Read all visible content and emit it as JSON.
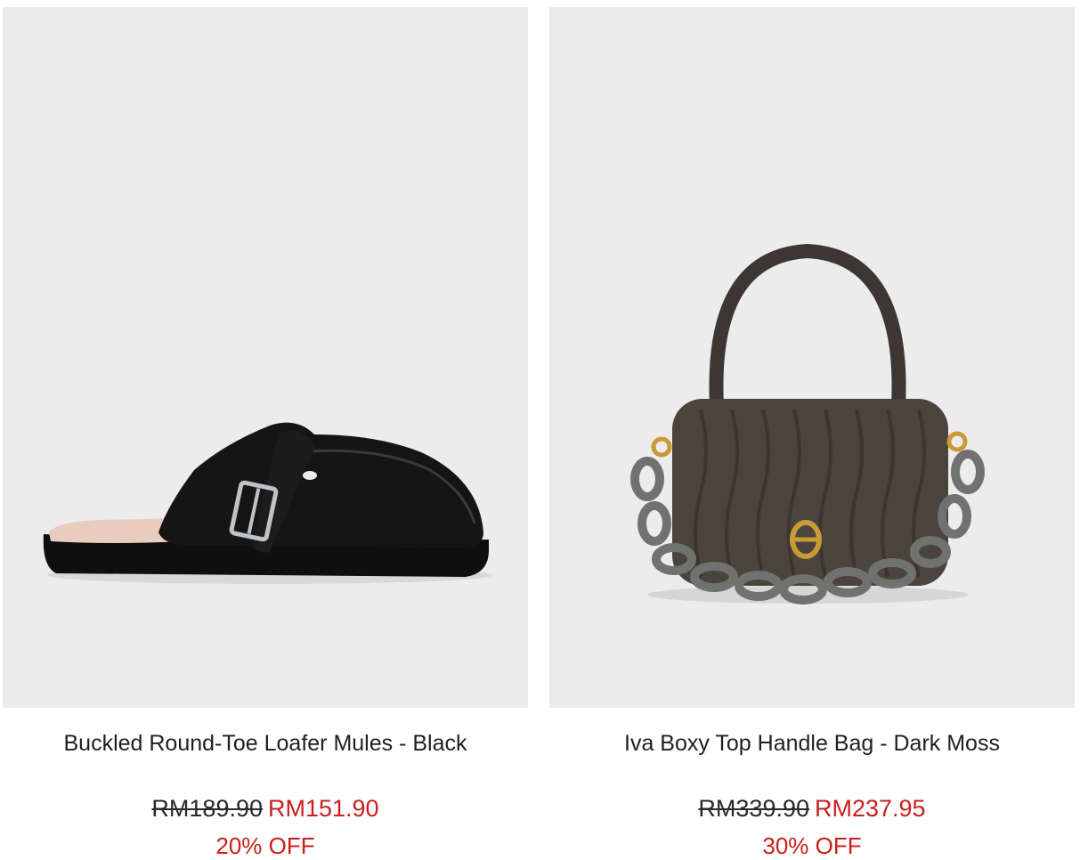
{
  "products": [
    {
      "image_icon": "loafer-mule-icon",
      "name": "Buckled Round-Toe Loafer Mules - Black",
      "original_price": "RM189.90",
      "sale_price": "RM151.90",
      "discount": "20% OFF"
    },
    {
      "image_icon": "top-handle-bag-icon",
      "name": "Iva Boxy Top Handle Bag - Dark Moss",
      "original_price": "RM339.90",
      "sale_price": "RM237.95",
      "discount": "30% OFF"
    }
  ],
  "colors": {
    "image_background": "#ececec",
    "sale_red": "#c8201c",
    "text": "#1f1f1f"
  }
}
